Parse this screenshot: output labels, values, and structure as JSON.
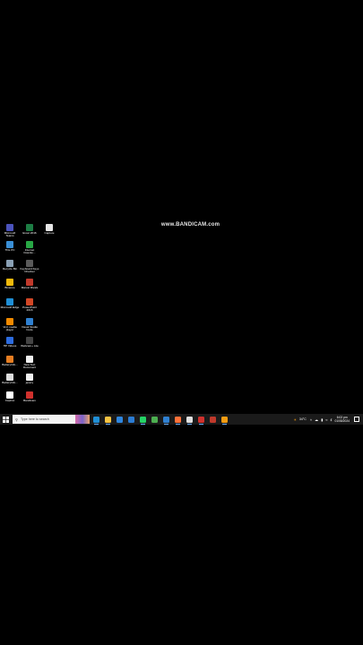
{
  "watermark": "www.BANDICAM.com",
  "desktop_icons": [
    {
      "label": "Microsoft Teams",
      "color": "#4b53bc",
      "name": "teams-desktop-icon"
    },
    {
      "label": "Excel 2016",
      "color": "#1d7d44",
      "name": "excel-desktop-icon"
    },
    {
      "label": "Capture",
      "color": "#e6e6e6",
      "name": "capture-desktop-icon"
    },
    {
      "label": "This PC",
      "color": "#3a8fd6",
      "name": "this-pc-desktop-icon"
    },
    {
      "label": "Internet Downlo...",
      "color": "#28a745",
      "name": "idm-desktop-icon"
    },
    {
      "label": "Recycle Bin",
      "color": "#8aa0b4",
      "name": "recycle-bin-desktop-icon"
    },
    {
      "label": "Keyboard Keys Checker",
      "color": "#5a5a5a",
      "name": "keyboard-checker-desktop-icon"
    },
    {
      "label": "Binance",
      "color": "#f0b90b",
      "name": "binance-desktop-icon"
    },
    {
      "label": "Marvel Rivals",
      "color": "#c0392b",
      "name": "marvel-desktop-icon"
    },
    {
      "label": "Microsoft Edge",
      "color": "#1f8fd6",
      "name": "edge-desktop-icon"
    },
    {
      "label": "PowerPoint 2016",
      "color": "#d24726",
      "name": "powerpoint-desktop-icon"
    },
    {
      "label": "VLC media player",
      "color": "#f28a00",
      "name": "vlc-desktop-icon"
    },
    {
      "label": "Visual Studio Code",
      "color": "#2f80d1",
      "name": "vscode-desktop-icon"
    },
    {
      "label": "HP Videos",
      "color": "#2d6cdf",
      "name": "hp-videos-desktop-icon"
    },
    {
      "label": "Webcam+ Lite",
      "color": "#444444",
      "name": "webcam-desktop-icon"
    },
    {
      "label": "BatteryInfo...",
      "color": "#e67e22",
      "name": "batteryinfo-desktop-icon"
    },
    {
      "label": "New Text Document",
      "color": "#f0f0f0",
      "name": "new-text-doc-desktop-icon"
    },
    {
      "label": "BatteryInfo...",
      "color": "#dddddd",
      "name": "batteryinfo2-desktop-icon"
    },
    {
      "label": "jquery",
      "color": "#f0f0f0",
      "name": "jquery-desktop-icon"
    },
    {
      "label": "CapCut",
      "color": "#ffffff",
      "name": "capcut-desktop-icon"
    },
    {
      "label": "Bandicam",
      "color": "#d0312d",
      "name": "bandicam-desktop-icon"
    }
  ],
  "taskbar": {
    "search_placeholder": "Type here to search",
    "apps": [
      {
        "name": "edge-taskbar-icon",
        "color": "#1f8fd6",
        "active": true
      },
      {
        "name": "file-explorer-taskbar-icon",
        "color": "#f5c342",
        "active": true
      },
      {
        "name": "store-taskbar-icon",
        "color": "#2e86de",
        "active": false
      },
      {
        "name": "mail-taskbar-icon",
        "color": "#2b7cd3",
        "active": false
      },
      {
        "name": "whatsapp-taskbar-icon",
        "color": "#25d366",
        "active": true
      },
      {
        "name": "chrome-taskbar-icon",
        "color": "#4caf50",
        "active": false
      },
      {
        "name": "vscode-taskbar-icon",
        "color": "#2f80d1",
        "active": true
      },
      {
        "name": "firefox-taskbar-icon",
        "color": "#ff7139",
        "active": true
      },
      {
        "name": "capcut-taskbar-icon",
        "color": "#e0e0e0",
        "active": true
      },
      {
        "name": "bandicam-taskbar-icon",
        "color": "#d0312d",
        "active": true
      },
      {
        "name": "recorder-taskbar-icon",
        "color": "#c0392b",
        "active": false
      },
      {
        "name": "app-taskbar-icon",
        "color": "#f39c12",
        "active": true
      }
    ],
    "weather": "34°C",
    "time": "6:02 pm",
    "date": "01/08/2024"
  }
}
